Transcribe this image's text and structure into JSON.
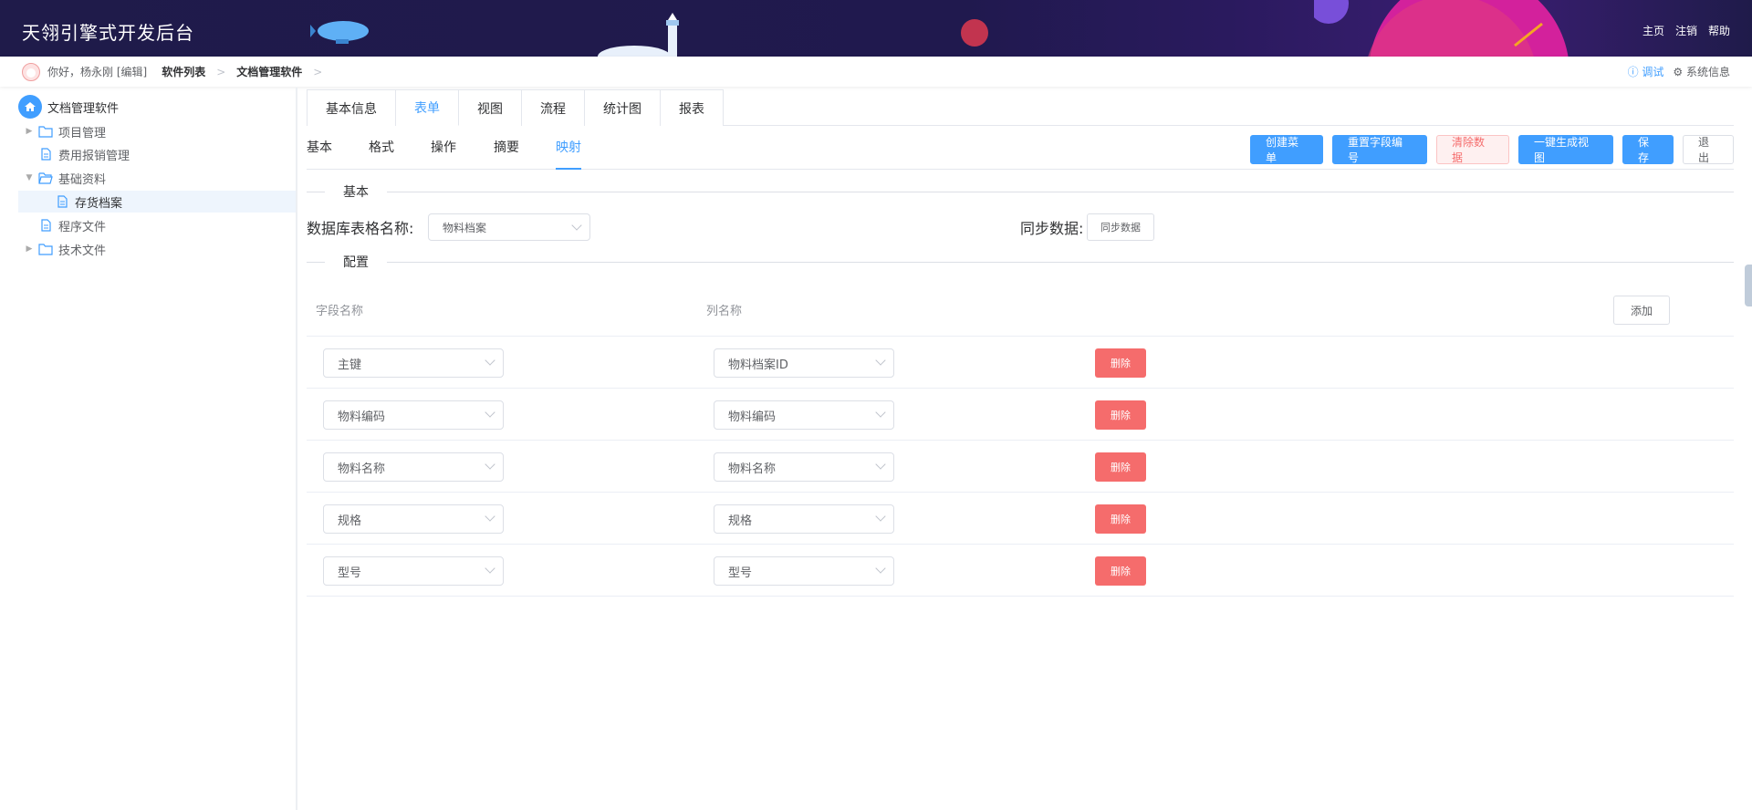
{
  "header": {
    "app_title": "天翎引擎式开发后台",
    "links": [
      "主页",
      "注销",
      "帮助"
    ]
  },
  "subheader": {
    "greeting": "你好，杨永刚 [编辑]",
    "crumbs": [
      "软件列表",
      "文档管理软件"
    ],
    "debug_label": "调试",
    "sysinfo_label": "系统信息"
  },
  "sidebar": {
    "root": "文档管理软件",
    "items": [
      {
        "label": "项目管理",
        "type": "folder",
        "expanded": false
      },
      {
        "label": "费用报销管理",
        "type": "file"
      },
      {
        "label": "基础资料",
        "type": "folder",
        "expanded": true
      },
      {
        "label": "存货档案",
        "type": "file",
        "active": true
      },
      {
        "label": "程序文件",
        "type": "file"
      },
      {
        "label": "技术文件",
        "type": "folder",
        "expanded": false
      }
    ]
  },
  "tabs": [
    "基本信息",
    "表单",
    "视图",
    "流程",
    "统计图",
    "报表"
  ],
  "active_tab": "表单",
  "subtabs": [
    "基本",
    "格式",
    "操作",
    "摘要",
    "映射"
  ],
  "active_subtab": "映射",
  "toolbar": [
    "创建菜单",
    "重置字段编号",
    "清除数据",
    "一键生成视图",
    "保存",
    "退出"
  ],
  "section_basic": {
    "title": "基本",
    "table_label": "数据库表格名称:",
    "table_value": "物料档案",
    "sync_label": "同步数据:",
    "sync_button": "同步数据"
  },
  "section_config": {
    "title": "配置",
    "col_field": "字段名称",
    "col_column": "列名称",
    "add_button": "添加",
    "delete_label": "删除",
    "rows": [
      {
        "field": "主键",
        "column": "物料档案ID"
      },
      {
        "field": "物料编码",
        "column": "物料编码"
      },
      {
        "field": "物料名称",
        "column": "物料名称"
      },
      {
        "field": "规格",
        "column": "规格"
      },
      {
        "field": "型号",
        "column": "型号"
      }
    ]
  },
  "colors": {
    "primary": "#409eff",
    "danger": "#f56c6c",
    "header_bg": "#1f1b4a"
  }
}
